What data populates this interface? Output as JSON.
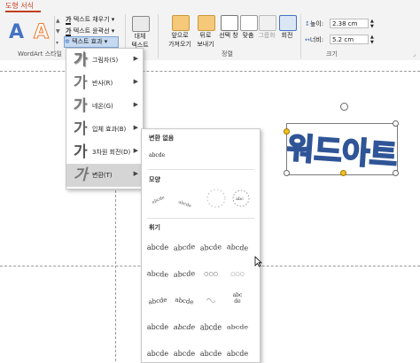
{
  "ribbon": {
    "active_tab": "도형 서식",
    "wordart_group_label": "WordArt 스타일",
    "text_fill": "텍스트 채우기",
    "text_outline": "텍스트 윤곽선",
    "text_effects": "텍스트 효과",
    "alt_text_line1": "대체",
    "alt_text_line2": "텍스트",
    "bring_forward_line1": "앞으로",
    "bring_forward_line2": "가져오기",
    "send_backward_line1": "뒤로",
    "send_backward_line2": "보내기",
    "selection_pane_line1": "선택 창",
    "align_label": "맞춤",
    "group_label": "그룹화",
    "rotate_label": "회전",
    "arrange_group_label": "정렬",
    "height_label": "높이:",
    "height_value": "2.38 cm",
    "width_label": "너비:",
    "width_value": "5.2 cm",
    "size_group_label": "크기"
  },
  "menu": {
    "items": [
      {
        "icon": "가",
        "label": "그림자(S)"
      },
      {
        "icon": "가",
        "label": "반사(R)"
      },
      {
        "icon": "가",
        "label": "네온(G)"
      },
      {
        "icon": "가",
        "label": "입체 효과(B)"
      },
      {
        "icon": "가",
        "label": "3차원 회전(D)"
      },
      {
        "icon": "가",
        "label": "변환(T)"
      }
    ]
  },
  "submenu": {
    "no_transform_header": "변환 없음",
    "no_transform_sample": "abcde",
    "path_header": "모양",
    "warp_header": "휘기",
    "warp_sample": "abcde"
  },
  "wordart": {
    "text": "워드아트",
    "fill_color": "#a9c4ec",
    "outline_color": "#2f5597"
  },
  "colors": {
    "accent": "#c43e1c",
    "wordart_blue": "#4472c4",
    "wordart_orange": "#ed7d31"
  }
}
